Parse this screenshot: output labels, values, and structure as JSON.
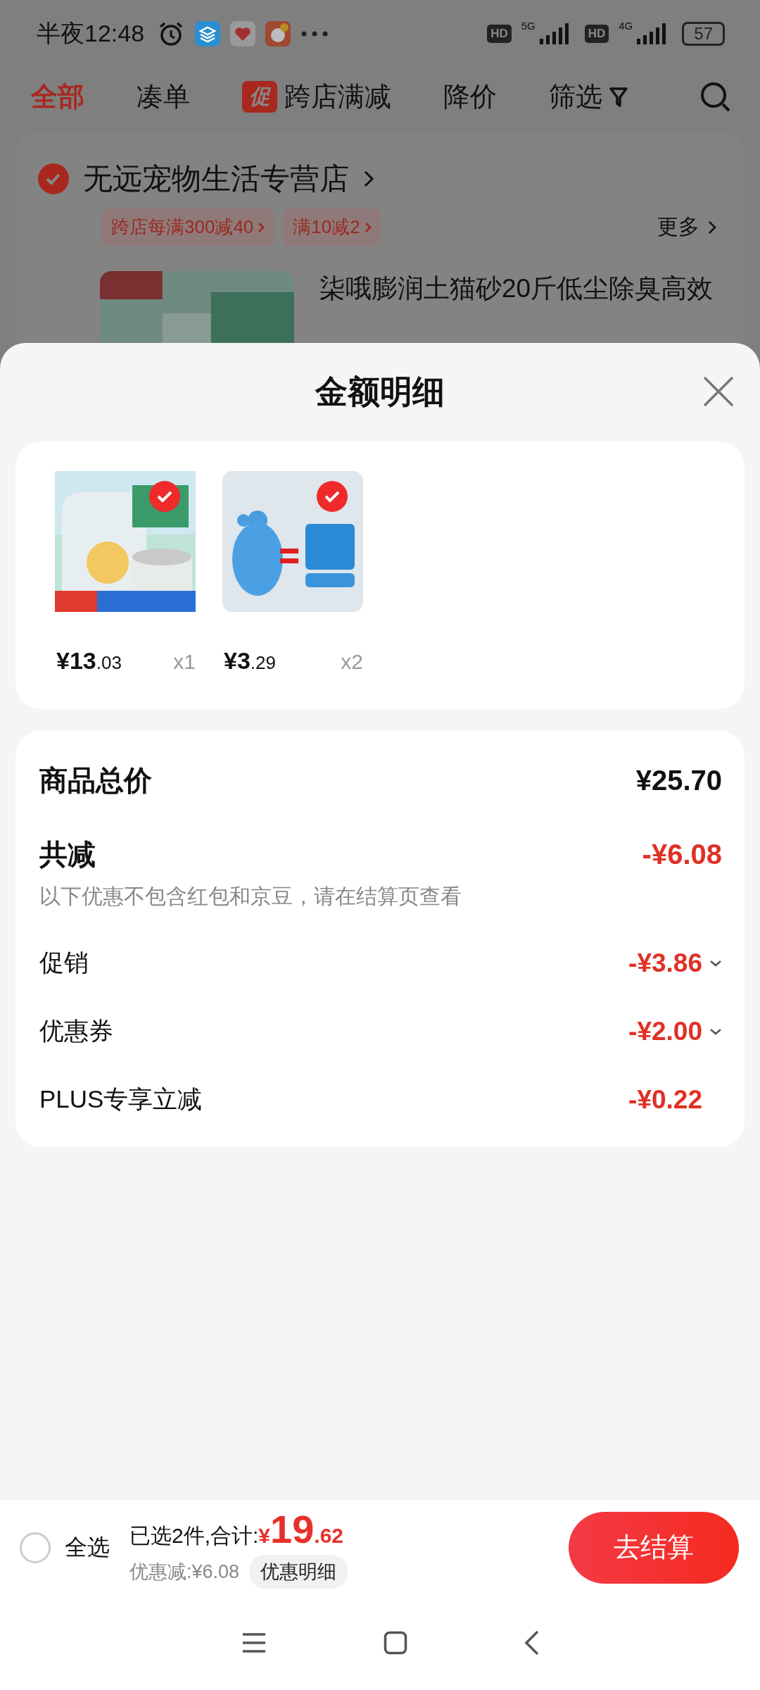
{
  "status_bar": {
    "time": "半夜12:48",
    "signals": [
      {
        "badge": "HD",
        "network": "5G"
      },
      {
        "badge": "HD",
        "network": "4G"
      }
    ],
    "battery": "57"
  },
  "tabs": [
    {
      "label": "全部",
      "selected": true
    },
    {
      "label": "凑单",
      "selected": false
    },
    {
      "label": "跨店满减",
      "selected": false,
      "badge": "促"
    },
    {
      "label": "降价",
      "selected": false
    },
    {
      "label": "筛选",
      "selected": false,
      "filter": true
    }
  ],
  "store": {
    "name": "无远宠物生活专营店",
    "checked": true,
    "promos": [
      "跨店每满300减40",
      "满10减2"
    ],
    "more": "更多",
    "product_title": "柒哦膨润土猫砂20斤低尘除臭高效"
  },
  "sheet": {
    "title": "金额明细",
    "products": [
      {
        "kind": "litter",
        "price_main": "¥13",
        "price_decimal": ".03",
        "quantity": "x1",
        "checked": true
      },
      {
        "kind": "cleaner",
        "price_main": "¥3",
        "price_decimal": ".29",
        "quantity": "x2",
        "checked": true
      }
    ],
    "summary": [
      {
        "kind": "total",
        "label": "商品总价",
        "value": "¥25.70"
      },
      {
        "kind": "discount_total",
        "label": "共减",
        "value": "-¥6.08",
        "note": "以下优惠不包含红包和京豆，请在结算页查看"
      },
      {
        "kind": "item",
        "label": "促销",
        "value": "-¥3.86",
        "expandable": true
      },
      {
        "kind": "item",
        "label": "优惠券",
        "value": "-¥2.00",
        "expandable": true
      },
      {
        "kind": "item",
        "label": "PLUS专享立减",
        "value": "-¥0.22",
        "expandable": false
      }
    ]
  },
  "bottom_bar": {
    "select_all": {
      "label": "全选",
      "checked": false
    },
    "selected_text": "已选2件,合计:",
    "currency": "¥",
    "total_main": "19",
    "total_decimal": ".62",
    "discount": "优惠减:¥6.08",
    "detail_button": "优惠明细",
    "checkout": "去结算"
  }
}
